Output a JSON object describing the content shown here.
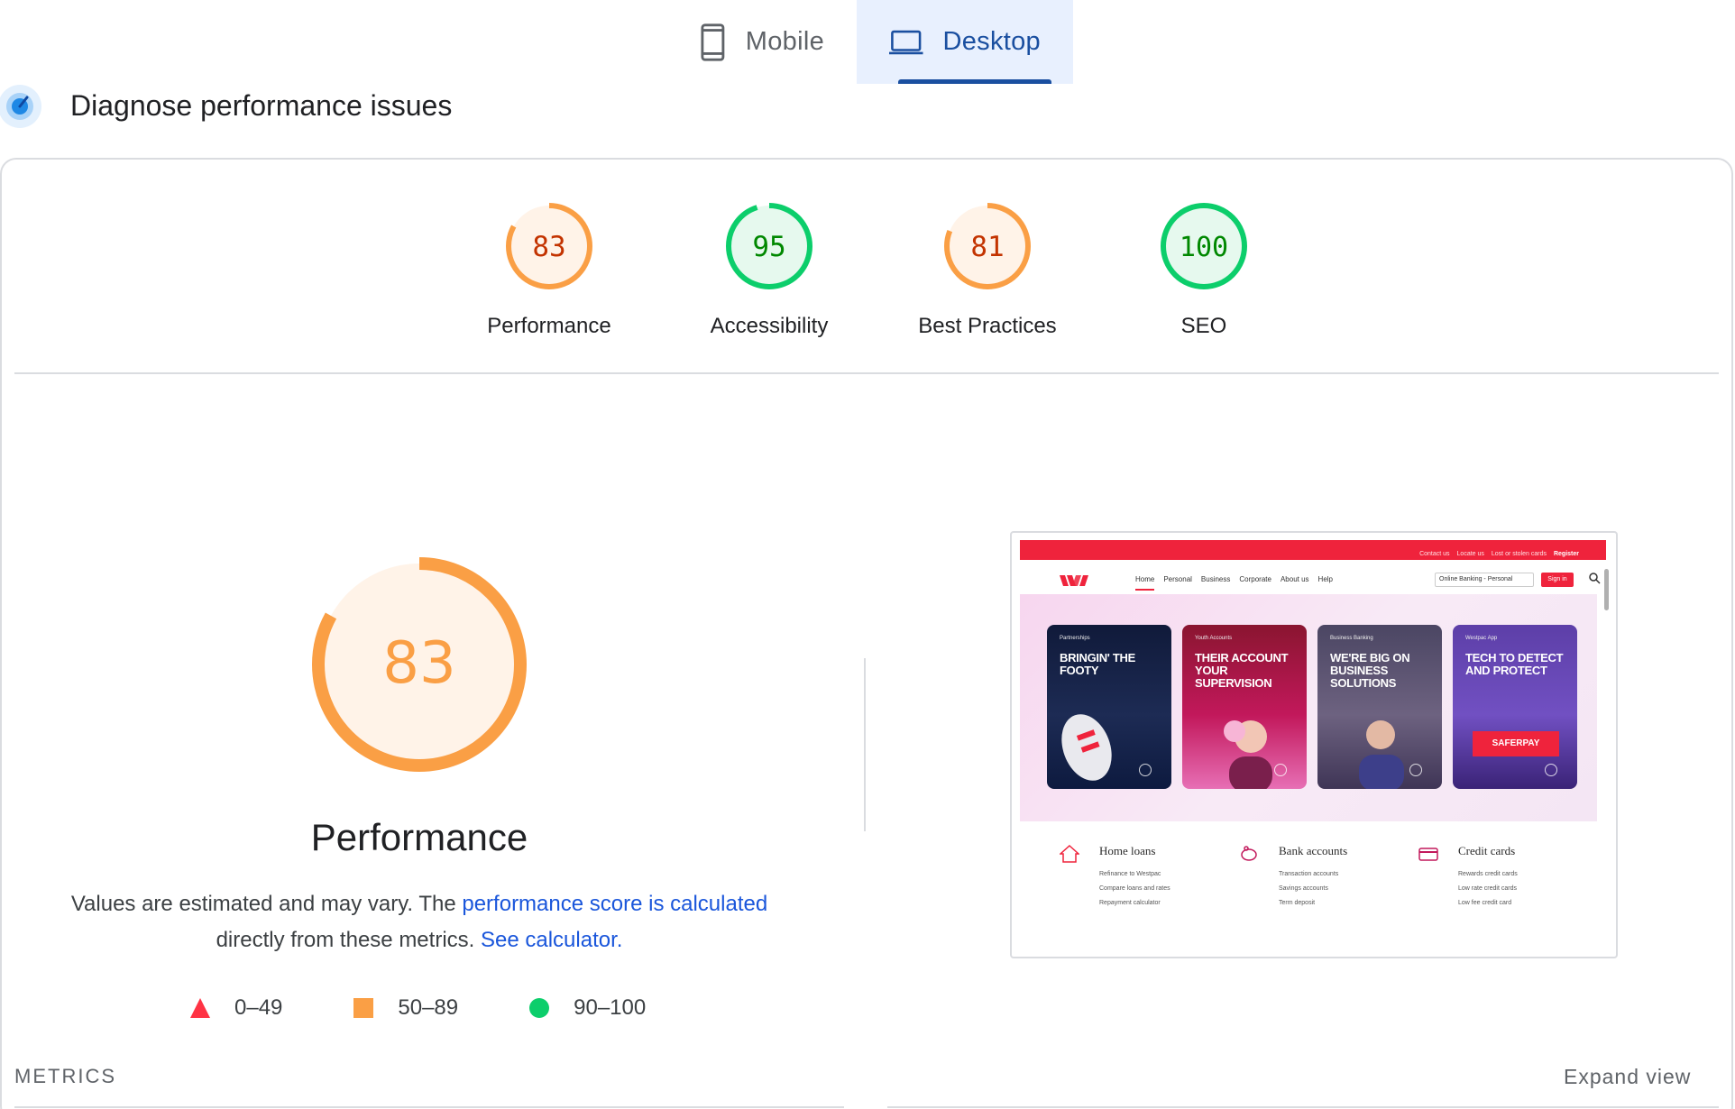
{
  "tabs": [
    {
      "label": "Mobile",
      "icon": "phone-icon",
      "active": false
    },
    {
      "label": "Desktop",
      "icon": "laptop-icon",
      "active": true
    }
  ],
  "header": {
    "title": "Diagnose performance issues",
    "icon": "gauge-icon"
  },
  "scores": [
    {
      "label": "Performance",
      "value": 83,
      "status": "average"
    },
    {
      "label": "Accessibility",
      "value": 95,
      "status": "pass"
    },
    {
      "label": "Best Practices",
      "value": 81,
      "status": "average"
    },
    {
      "label": "SEO",
      "value": 100,
      "status": "pass"
    }
  ],
  "colors": {
    "average": "#fa9f45",
    "average_text": "#c33300",
    "average_bg": "#fff3e8",
    "pass": "#0cce6b",
    "pass_text": "#008800",
    "pass_bg": "#e6f9ee",
    "fail": "#ff3344",
    "link": "#1a56db",
    "tab_active": "#1a4fa0"
  },
  "performance": {
    "score": "83",
    "title": "Performance",
    "desc_before": "Values are estimated and may vary. The ",
    "desc_link1": "performance score is calculated",
    "desc_middle": " directly from these metrics. ",
    "desc_link2": "See calculator."
  },
  "legend": [
    {
      "range": "0–49",
      "shape": "triangle",
      "color": "#ff3344"
    },
    {
      "range": "50–89",
      "shape": "square",
      "color": "#fa9f45"
    },
    {
      "range": "90–100",
      "shape": "circle",
      "color": "#0cce6b"
    }
  ],
  "preview": {
    "top_links": [
      "Contact us",
      "Locate us",
      "Lost or stolen cards",
      "Register"
    ],
    "nav_links": [
      "Home",
      "Personal",
      "Business",
      "Corporate",
      "About us",
      "Help"
    ],
    "banking_select": "Online Banking - Personal",
    "signin": "Sign in",
    "cards": [
      {
        "tag": "Partnerships",
        "headline": "BRINGIN' THE FOOTY"
      },
      {
        "tag": "Youth Accounts",
        "headline": "THEIR ACCOUNT YOUR SUPERVISION"
      },
      {
        "tag": "Business Banking",
        "headline": "WE'RE BIG ON BUSINESS SOLUTIONS"
      },
      {
        "tag": "Westpac App",
        "headline": "TECH TO DETECT AND PROTECT"
      }
    ],
    "saferpay": "SAFERPAY",
    "products": [
      {
        "title": "Home loans",
        "items": [
          "Refinance to Westpac",
          "Compare loans and rates",
          "Repayment calculator"
        ]
      },
      {
        "title": "Bank accounts",
        "items": [
          "Transaction accounts",
          "Savings accounts",
          "Term deposit"
        ]
      },
      {
        "title": "Credit cards",
        "items": [
          "Rewards credit cards",
          "Low rate credit cards",
          "Low fee credit card"
        ]
      }
    ]
  },
  "footer": {
    "metrics": "METRICS",
    "expand": "Expand view"
  }
}
